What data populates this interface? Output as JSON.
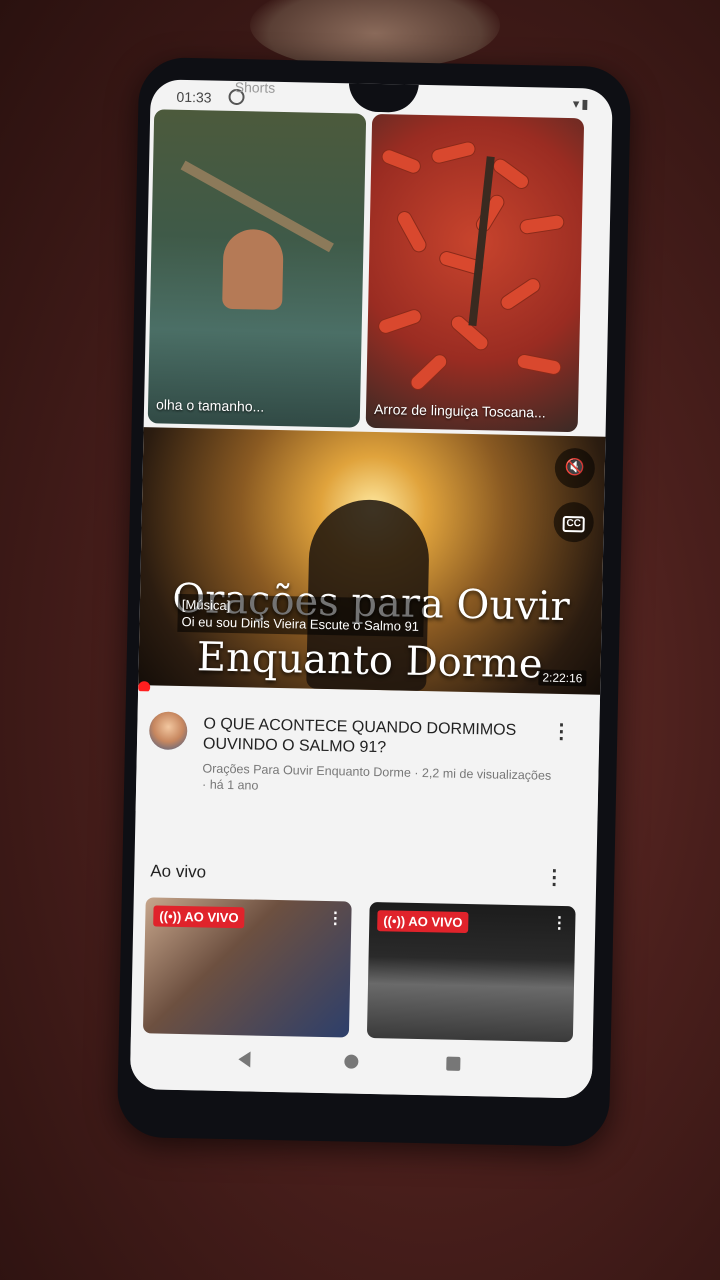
{
  "status_bar": {
    "time": "01:33"
  },
  "shorts_header": {
    "label": "Shorts"
  },
  "shorts": [
    {
      "caption": "olha o tamanho..."
    },
    {
      "caption": "Arroz de linguiça Toscana..."
    }
  ],
  "video": {
    "title_line1": "Orações para Ouvir",
    "title_line2": "Enquanto Dorme",
    "subtitle_line1": "[Música]",
    "subtitle_line2": "Oi eu sou Dinis Vieira Escute o Salmo 91",
    "duration": "2:22:16",
    "mute_icon": "mute-icon",
    "cc_label": "CC"
  },
  "video_info": {
    "title": "O QUE ACONTECE QUANDO DORMIMOS OUVINDO O SALMO 91?",
    "meta": "Orações Para Ouvir Enquanto Dorme · 2,2 mi de visualizações · há 1 ano"
  },
  "live_section": {
    "title": "Ao vivo",
    "cards": [
      {
        "badge": "AO VIVO"
      },
      {
        "badge": "AO VIVO"
      }
    ]
  },
  "colors": {
    "accent": "#ff1f1f",
    "live_badge": "#e0232b"
  }
}
